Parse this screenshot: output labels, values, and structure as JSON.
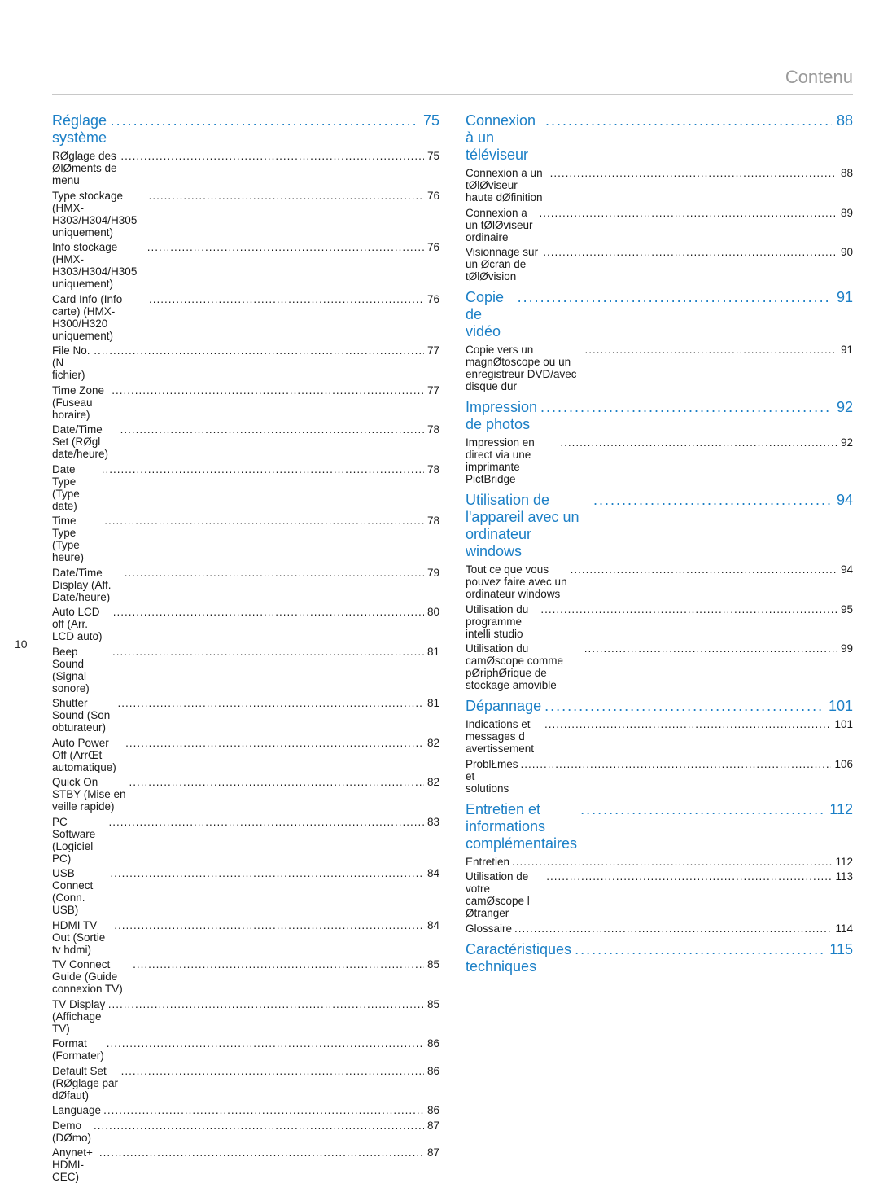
{
  "header_title": "Contenu",
  "page_label": "10",
  "leader_section": "..............................................................................................................",
  "leader_sub": "...............................................................................................................................................................................................",
  "left": [
    {
      "title": "Réglage système",
      "page": "75",
      "items": [
        {
          "text": "RØglage des ØlØments de menu",
          "page": "75"
        },
        {
          "text": "Type stockage (HMX-H303/H304/H305 uniquement)",
          "page": "76"
        },
        {
          "text": "Info stockage (HMX-H303/H304/H305 uniquement)",
          "page": "76"
        },
        {
          "text": "Card Info (Info carte) (HMX-H300/H320 uniquement)",
          "page": "76"
        },
        {
          "text": "File No. (N  fichier)",
          "page": "77"
        },
        {
          "text": "Time Zone (Fuseau horaire)",
          "page": "77"
        },
        {
          "text": "Date/Time Set (RØgl date/heure)",
          "page": "78"
        },
        {
          "text": "Date Type (Type date)",
          "page": "78"
        },
        {
          "text": "Time Type (Type heure)",
          "page": "78"
        },
        {
          "text": "Date/Time Display (Aff. Date/heure)",
          "page": "79"
        },
        {
          "text": "Auto LCD off (Arr. LCD auto)",
          "page": "80"
        },
        {
          "text": "Beep Sound (Signal sonore)",
          "page": "81"
        },
        {
          "text": "Shutter Sound (Son obturateur)",
          "page": "81"
        },
        {
          "text": "Auto Power Off (ArrŒt automatique)",
          "page": "82"
        },
        {
          "text": "Quick On STBY (Mise en veille rapide)",
          "page": "82"
        },
        {
          "text": "PC Software (Logiciel PC)",
          "page": "83"
        },
        {
          "text": "USB Connect (Conn. USB)",
          "page": "84"
        },
        {
          "text": "HDMI TV Out (Sortie tv hdmi)",
          "page": "84"
        },
        {
          "text": "TV Connect Guide (Guide connexion TV)",
          "page": "85"
        },
        {
          "text": "TV Display (Affichage TV)",
          "page": "85"
        },
        {
          "text": "Format (Formater)",
          "page": "86"
        },
        {
          "text": "Default Set (RØglage par dØfaut)",
          "page": "86"
        },
        {
          "text": "Language",
          "page": "86"
        },
        {
          "text": "Demo (DØmo)",
          "page": "87"
        },
        {
          "text": "Anynet+ HDMI-CEC)",
          "page": "87"
        }
      ]
    }
  ],
  "right": [
    {
      "title": "Connexion à un téléviseur",
      "page": "88",
      "items": [
        {
          "text": "Connexion a un tØlØviseur haute dØfinition",
          "page": "88"
        },
        {
          "text": "Connexion a un tØlØviseur ordinaire",
          "page": "89"
        },
        {
          "text": "Visionnage sur un Øcran de tØlØvision",
          "page": "90"
        }
      ]
    },
    {
      "title": "Copie de vidéo",
      "page": "91",
      "items": [
        {
          "text": "Copie vers un magnØtoscope ou un enregistreur DVD/avec disque dur",
          "page": "91"
        }
      ]
    },
    {
      "title": "Impression de photos",
      "page": "92",
      "items": [
        {
          "text": "Impression en direct via une imprimante PictBridge",
          "page": "92"
        }
      ]
    },
    {
      "title": "Utilisation de l'appareil avec un ordinateur windows",
      "page": "94",
      "long": true,
      "items": [
        {
          "text": "Tout ce que vous pouvez faire avec un ordinateur windows",
          "page": "94"
        },
        {
          "text": "Utilisation du programme intelli   studio",
          "page": "95"
        },
        {
          "text": "Utilisation du camØscope comme pØriphØrique de stockage amovible",
          "page": "99"
        }
      ]
    },
    {
      "title": "Dépannage",
      "page": "101",
      "items": [
        {
          "text": "Indications et messages d avertissement",
          "page": "101"
        },
        {
          "text": "ProblŁmes et solutions",
          "page": "106"
        }
      ]
    },
    {
      "title": "Entretien et informations complémentaires",
      "page": "112",
      "items": [
        {
          "text": "Entretien",
          "page": "112"
        },
        {
          "text": "Utilisation de votre camØscope   l Øtranger",
          "page": "113"
        },
        {
          "text": "Glossaire",
          "page": "114"
        }
      ]
    },
    {
      "title": "Caractéristiques techniques",
      "page": "115",
      "items": []
    }
  ]
}
